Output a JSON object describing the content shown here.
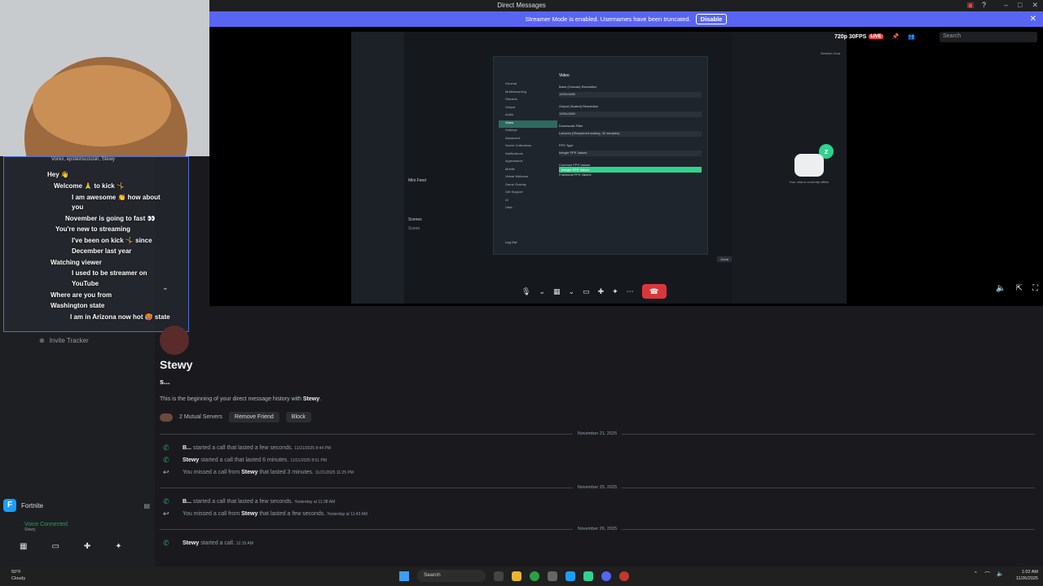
{
  "window": {
    "title": "Direct Messages",
    "controls": [
      "–",
      "□",
      "✕"
    ]
  },
  "banner": {
    "text": "Streamer Mode is enabled. Usernames have been truncated.",
    "button": "Disable"
  },
  "stream": {
    "quality": "720p 30FPS",
    "live": "LIVE",
    "search_placeholder": "Search",
    "obs": {
      "menu": [
        "General",
        "Multistreaming",
        "Streams",
        "Output",
        "Audio",
        "Video",
        "Hotkeys",
        "Advanced",
        "Scene Collections",
        "Notifications",
        "Appearance",
        "Mobile",
        "Virtual Webcam",
        "Game Overlay",
        "Get Support",
        "AI",
        "Ultra"
      ],
      "selected_menu": "Video",
      "section": "Video",
      "fields": [
        {
          "label": "Base (Canvas) Resolution",
          "value": "1920x1080"
        },
        {
          "label": "Output (Scaled) Resolution",
          "value": "1920x1080"
        },
        {
          "label": "Downscale Filter",
          "value": "Lanczos (Sharpened scaling, 32 samples)"
        },
        {
          "label": "FPS Type",
          "value": "Integer FPS Values"
        }
      ],
      "dropdown": [
        "Common FPS Values",
        "Integer FPS Values",
        "Fractional FPS Values"
      ],
      "dropdown_selected": "Integer FPS Values",
      "mini_feed": "Mini Feed",
      "scenes": "Scenes",
      "scene_item": "Scene",
      "log_out": "Log Out",
      "done": "Done",
      "offline_text": "Your chat is currently offline",
      "refresh_chat": "Refresh Chat"
    }
  },
  "chat_overlay": {
    "header": "Vorex, epsteinscousin, Stewy",
    "lines": [
      {
        "text": "Hey 👋"
      },
      {
        "text": "Welcome 🙏 to kick 🤸"
      },
      {
        "text": "I am awesome 👏 how about"
      },
      {
        "text": "you"
      },
      {
        "text": "November is going to fast 👀"
      },
      {
        "text": "You're new to streaming"
      },
      {
        "text": "I've been on kick 🤸 since"
      },
      {
        "text": "December last year"
      },
      {
        "text": "Watching viewer"
      },
      {
        "text": "I used to be streamer on"
      },
      {
        "text": "YouTube"
      },
      {
        "text": "Where are you from"
      },
      {
        "text": "Washington state"
      },
      {
        "text": "I am in Arizona now hot 🥵 state"
      }
    ]
  },
  "sidebar": {
    "invite_tracker": "Invite Tracker",
    "server": "Fortnite",
    "voice_status": "Voice Connected",
    "voice_channel": "Stewy"
  },
  "dm": {
    "name": "Stewy",
    "subtitle": "s...",
    "begin_prefix": "This is the beginning of your direct message history with ",
    "begin_name": "Stewy",
    "mutual": "2 Mutual Servers",
    "remove_friend": "Remove Friend",
    "block": "Block"
  },
  "history": [
    {
      "date": "November 21, 2025"
    },
    {
      "user": "B...",
      "text": "started a call that lasted a few seconds.",
      "time": "11/21/2025 8:44 PM",
      "missed": false
    },
    {
      "user": "Stewy",
      "text": "started a call that lasted 6 minutes.",
      "time": "11/21/2025 8:51 PM",
      "missed": false
    },
    {
      "prefix": "You missed a call from",
      "user": "Stewy",
      "text": "that lasted 3 minutes.",
      "time": "11/21/2025 11:25 PM",
      "missed": true
    },
    {
      "date": "November 25, 2025"
    },
    {
      "user": "B...",
      "text": "started a call that lasted a few seconds.",
      "time": "Yesterday at 11:38 AM",
      "missed": false
    },
    {
      "prefix": "You missed a call from",
      "user": "Stewy",
      "text": "that lasted a few seconds.",
      "time": "Yesterday at 11:43 AM",
      "missed": true
    },
    {
      "date": "November 26, 2025"
    },
    {
      "user": "Stewy",
      "text": "started a call.",
      "time": "12:15 AM",
      "missed": false
    }
  ],
  "taskbar": {
    "temp": "50°F",
    "weather": "Cloudy",
    "search": "Search",
    "time": "1:02 AM",
    "date": "11/26/2025"
  }
}
